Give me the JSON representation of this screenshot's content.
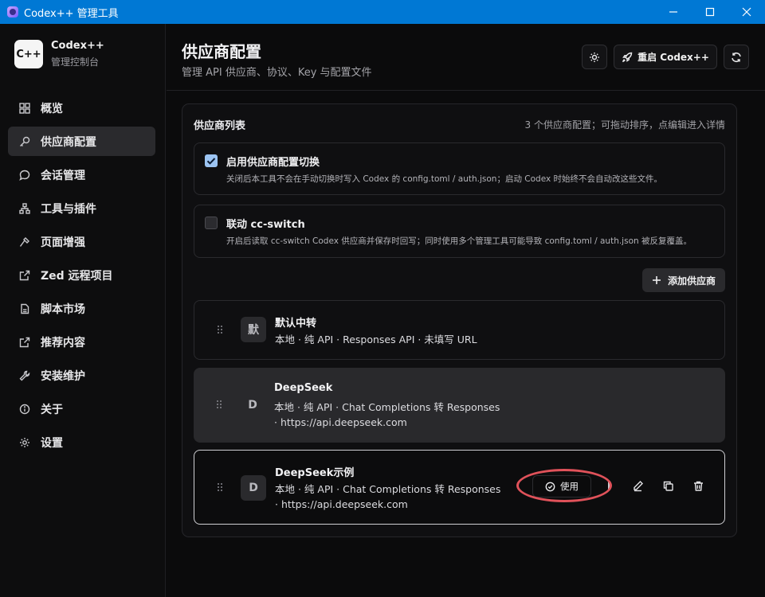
{
  "window": {
    "title": "Codex++ 管理工具"
  },
  "brand": {
    "logo": "C++",
    "name": "Codex++",
    "subtitle": "管理控制台"
  },
  "nav": [
    {
      "label": "概览",
      "icon": "grid-icon",
      "active": false
    },
    {
      "label": "供应商配置",
      "icon": "key-icon",
      "active": true
    },
    {
      "label": "会话管理",
      "icon": "chat-bubble-icon",
      "active": false
    },
    {
      "label": "工具与插件",
      "icon": "network-icon",
      "active": false
    },
    {
      "label": "页面增强",
      "icon": "hammer-icon",
      "active": false
    },
    {
      "label": "Zed 远程项目",
      "icon": "external-link-icon",
      "active": false
    },
    {
      "label": "脚本市场",
      "icon": "document-icon",
      "active": false
    },
    {
      "label": "推荐内容",
      "icon": "external-link-icon",
      "active": false
    },
    {
      "label": "安装维护",
      "icon": "wrench-icon",
      "active": false
    },
    {
      "label": "关于",
      "icon": "info-icon",
      "active": false
    },
    {
      "label": "设置",
      "icon": "gear-icon",
      "active": false
    }
  ],
  "header": {
    "title": "供应商配置",
    "subtitle": "管理 API 供应商、协议、Key 与配置文件",
    "restart_label": "重启 Codex++"
  },
  "panel": {
    "title": "供应商列表",
    "hint": "3 个供应商配置；可拖动排序，点编辑进入详情",
    "options": [
      {
        "title": "启用供应商配置切换",
        "checked": true,
        "desc": "关闭后本工具不会在手动切换时写入 Codex 的 config.toml / auth.json；启动 Codex 时始终不会自动改这些文件。"
      },
      {
        "title": "联动 cc-switch",
        "checked": false,
        "desc": "开启后读取 cc-switch Codex 供应商并保存时回写；同时使用多个管理工具可能导致 config.toml / auth.json 被反复覆盖。"
      }
    ],
    "add_label": "添加供应商",
    "providers": [
      {
        "avatar": "默",
        "name": "默认中转",
        "meta": "本地 · 纯 API · Responses API · 未填写 URL"
      },
      {
        "avatar": "D",
        "name": "DeepSeek",
        "meta": "本地 · 纯 API · Chat Completions 转 Responses · https://api.deepseek.com"
      },
      {
        "avatar": "D",
        "name": "DeepSeek示例",
        "meta": "本地 · 纯 API · Chat Completions 转 Responses · https://api.deepseek.com",
        "use_label": "使用"
      }
    ]
  },
  "colors": {
    "titlebar": "#0078d4",
    "highlight": "#e0525a",
    "checkbox_on": "#9cc4f2"
  }
}
